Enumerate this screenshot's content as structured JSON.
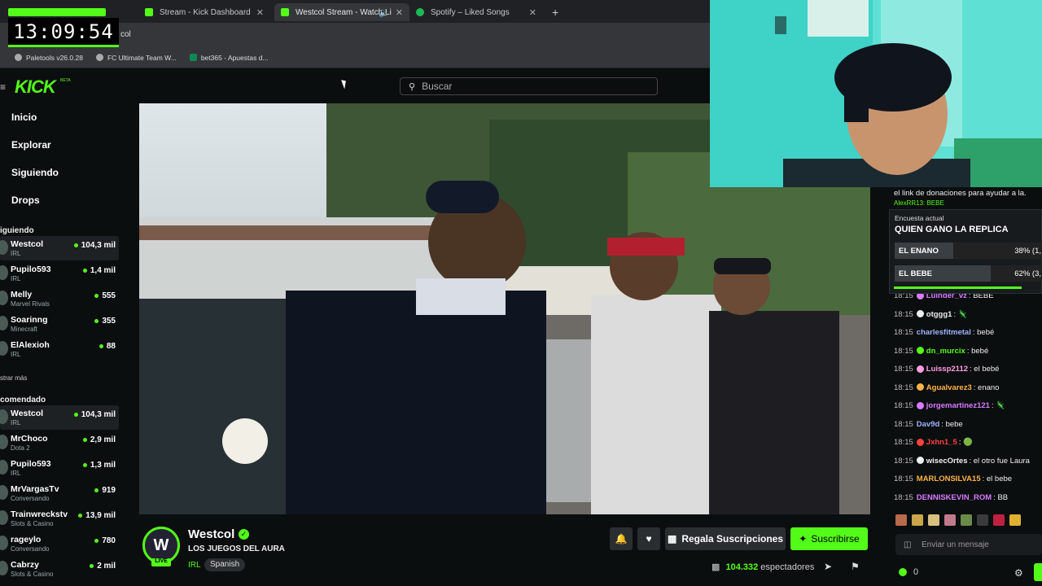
{
  "browser": {
    "tabs": [
      {
        "label": "Stream - Kick Dashboard",
        "color": "#53fc18"
      },
      {
        "label": "Westcol Stream - Watch Li",
        "color": "#53fc18"
      },
      {
        "label": "Spotify – Liked Songs",
        "color": "#1db954"
      }
    ],
    "new_tab": "+",
    "url_fragment": "col",
    "bookmarks": [
      "Paletools v26.0.28",
      "FC Ultimate Team W...",
      "bet365 - Apuestas d..."
    ]
  },
  "clock": "13:09:54",
  "kick": {
    "logo": "KICK",
    "beta": "BETA",
    "search_placeholder": "Buscar",
    "nav": [
      "Inicio",
      "Explorar",
      "Siguiendo",
      "Drops"
    ],
    "following_header": "iguiendo",
    "following": [
      {
        "name": "Westcol",
        "category": "IRL",
        "viewers": "104,3 mil"
      },
      {
        "name": "Pupilo593",
        "category": "IRL",
        "viewers": "1,4 mil"
      },
      {
        "name": "Melly",
        "category": "Marvel Rivals",
        "viewers": "555"
      },
      {
        "name": "Soarinng",
        "category": "Minecraft",
        "viewers": "355"
      },
      {
        "name": "ElAlexioh",
        "category": "IRL",
        "viewers": "88"
      }
    ],
    "show_more": "strar más",
    "recommended_header": "comendado",
    "recommended": [
      {
        "name": "Westcol",
        "category": "IRL",
        "viewers": "104,3 mil"
      },
      {
        "name": "MrChoco",
        "category": "Dota 2",
        "viewers": "2,9 mil"
      },
      {
        "name": "Pupilo593",
        "category": "IRL",
        "viewers": "1,3 mil"
      },
      {
        "name": "MrVargasTv",
        "category": "Conversando",
        "viewers": "919"
      },
      {
        "name": "Trainwreckstv",
        "category": "Slots & Casino",
        "viewers": "13,9 mil"
      },
      {
        "name": "rageylo",
        "category": "Conversando",
        "viewers": "780"
      },
      {
        "name": "Cabrzy",
        "category": "Slots & Casino",
        "viewers": "2 mil"
      }
    ]
  },
  "channel": {
    "avatar_letter": "W",
    "live": "LIVE",
    "name": "Westcol",
    "title": "LOS JUEGOS DEL AURA",
    "category": "IRL",
    "language": "Spanish",
    "gift_label": "Regala Suscripciones",
    "subscribe_label": "Suscribirse",
    "viewers": "104.332",
    "viewers_label": "espectadores"
  },
  "chat": {
    "pinned": "el link de donaciones para ayudar a la.",
    "pinned_user": "AlexRR13: BEBE",
    "poll": {
      "label": "Encuesta actual",
      "question": "QUIEN GANO LA REPLICA",
      "options": [
        {
          "label": "EL ENANO",
          "pct": "38% (1,",
          "value": 38
        },
        {
          "label": "EL BEBE",
          "pct": "62% (3,",
          "value": 62
        }
      ]
    },
    "messages": [
      {
        "time": "18:15",
        "user": "Luinder_vz",
        "text": "BEBE",
        "color": "#d77bff"
      },
      {
        "time": "18:15",
        "user": "otggg1",
        "text": "",
        "color": "#eeeeee",
        "emote": "🦎"
      },
      {
        "time": "18:15",
        "user": "charlesfitmetal",
        "text": "bebé",
        "color": "#9fb3ff"
      },
      {
        "time": "18:15",
        "user": "dn_murcix",
        "text": "bebé",
        "color": "#53fc18"
      },
      {
        "time": "18:15",
        "user": "Luissp2112",
        "text": "el bebé",
        "color": "#ff9de2"
      },
      {
        "time": "18:15",
        "user": "Agualvarez3",
        "text": "enano",
        "color": "#ffb347"
      },
      {
        "time": "18:15",
        "user": "jorgemartinez121",
        "text": "",
        "color": "#d77bff",
        "emote": "🦎"
      },
      {
        "time": "18:15",
        "user": "Dav9d",
        "text": "bebe",
        "color": "#9fb3ff"
      },
      {
        "time": "18:15",
        "user": "Jxhn1_5",
        "text": "",
        "color": "#ff4040",
        "emote": "🟢"
      },
      {
        "time": "18:15",
        "user": "wisecOrtes",
        "text": "el otro fue Laura",
        "color": "#eeeeee"
      },
      {
        "time": "18:15",
        "user": "MARLONSILVA15",
        "text": "el bebe",
        "color": "#ffb347"
      },
      {
        "time": "18:15",
        "user": "DENNISKEVIN_ROM",
        "text": "BB",
        "color": "#d77bff"
      }
    ],
    "input_placeholder": "Enviar un mensaje",
    "points": "0"
  }
}
